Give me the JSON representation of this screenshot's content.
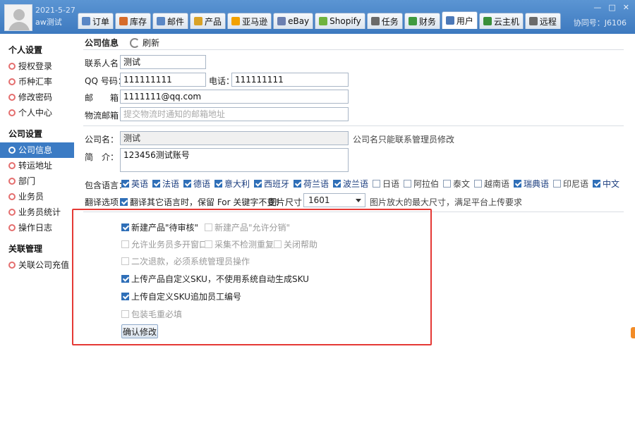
{
  "header": {
    "date": "2021-5-27",
    "username": "aw测试",
    "device_label": "协同号：J6106",
    "window_controls": [
      "—",
      "□",
      "✕"
    ],
    "tabs": [
      {
        "label": "订单",
        "icon": "order-icon",
        "color": "#5a87c5",
        "active": false
      },
      {
        "label": "库存",
        "icon": "inventory-icon",
        "color": "#d66b2a",
        "active": false
      },
      {
        "label": "邮件",
        "icon": "mail-icon",
        "color": "#5a87c5",
        "active": false
      },
      {
        "label": "产品",
        "icon": "product-icon",
        "color": "#d9a226",
        "active": false
      },
      {
        "label": "亚马逊",
        "icon": "amazon-icon",
        "color": "#f2a100",
        "active": false
      },
      {
        "label": "eBay",
        "icon": "ebay-icon",
        "color": "#6b7fb0",
        "active": false
      },
      {
        "label": "Shopify",
        "icon": "shopify-icon",
        "color": "#6fb33e",
        "active": false
      },
      {
        "label": "任务",
        "icon": "task-icon",
        "color": "#6a6a6a",
        "active": false
      },
      {
        "label": "财务",
        "icon": "finance-icon",
        "color": "#3f9a3f",
        "active": false
      },
      {
        "label": "用户",
        "icon": "user-icon",
        "color": "#4c79b8",
        "active": true
      },
      {
        "label": "云主机",
        "icon": "cloud-host-icon",
        "color": "#3a8f3a",
        "active": false
      },
      {
        "label": "远程",
        "icon": "remote-icon",
        "color": "#6a6a6a",
        "active": false
      }
    ]
  },
  "sidebar": {
    "sections": [
      {
        "title": "个人设置",
        "items": [
          {
            "label": "授权登录",
            "active": false
          },
          {
            "label": "币种汇率",
            "active": false
          },
          {
            "label": "修改密码",
            "active": false
          },
          {
            "label": "个人中心",
            "active": false
          }
        ]
      },
      {
        "title": "公司设置",
        "items": [
          {
            "label": "公司信息",
            "active": true
          },
          {
            "label": "转运地址",
            "active": false
          },
          {
            "label": "部门",
            "active": false
          },
          {
            "label": "业务员",
            "active": false
          },
          {
            "label": "业务员统计",
            "active": false
          },
          {
            "label": "操作日志",
            "active": false
          }
        ]
      },
      {
        "title": "关联管理",
        "items": [
          {
            "label": "关联公司充值",
            "active": false
          }
        ]
      }
    ]
  },
  "main": {
    "title": "公司信息",
    "refresh_label": "刷新",
    "form": {
      "contact_label": "联系人名：",
      "contact_value": "测试",
      "qq_label": "QQ 号码：",
      "qq_value": "111111111",
      "phone_label": "电话：",
      "phone_value": "111111111",
      "email_label": "邮　　箱：",
      "email_value": "1111111@qq.com",
      "logistics_label": "物流邮箱：",
      "logistics_placeholder": "提交物流时通知的邮箱地址",
      "company_label": "公司名：",
      "company_value": "测试",
      "company_note": "公司名只能联系管理员修改",
      "intro_label": "简　介：",
      "intro_value": "123456测试账号",
      "lang_label": "包含语言：",
      "languages": [
        {
          "label": "英语",
          "checked": true
        },
        {
          "label": "法语",
          "checked": true
        },
        {
          "label": "德语",
          "checked": true
        },
        {
          "label": "意大利",
          "checked": true
        },
        {
          "label": "西班牙",
          "checked": true
        },
        {
          "label": "荷兰语",
          "checked": true
        },
        {
          "label": "波兰语",
          "checked": true
        },
        {
          "label": "日语",
          "checked": false
        },
        {
          "label": "阿拉伯",
          "checked": false
        },
        {
          "label": "泰文",
          "checked": false
        },
        {
          "label": "越南语",
          "checked": false
        },
        {
          "label": "瑞典语",
          "checked": true
        },
        {
          "label": "印尼语",
          "checked": false
        },
        {
          "label": "中文",
          "checked": true
        }
      ],
      "translate_label": "翻译选项",
      "translate_option": "翻译其它语言时，保留 For 关键字不变!",
      "image_size_label": "图片尺寸：",
      "image_size_value": "1601",
      "image_size_note": "图片放大的最大尺寸，满足平台上传要求"
    },
    "options": [
      {
        "label": "新建产品\"待审核\"",
        "checked": true,
        "enabled": true
      },
      {
        "label": "新建产品\"允许分销\"",
        "checked": false,
        "enabled": false
      },
      {
        "label": "允许业务员多开窗口",
        "checked": false,
        "enabled": false
      },
      {
        "label": "采集不检测重复",
        "checked": false,
        "enabled": false
      },
      {
        "label": "关闭帮助",
        "checked": false,
        "enabled": false
      },
      {
        "label": "二次退款，必须系统管理员操作",
        "checked": false,
        "enabled": false
      },
      {
        "label": "上传产品自定义SKU，不使用系统自动生成SKU",
        "checked": true,
        "enabled": true
      },
      {
        "label": "上传自定义SKU追加员工编号",
        "checked": true,
        "enabled": true
      },
      {
        "label": "包装毛重必填",
        "checked": false,
        "enabled": false
      }
    ],
    "confirm_button": "确认修改"
  }
}
